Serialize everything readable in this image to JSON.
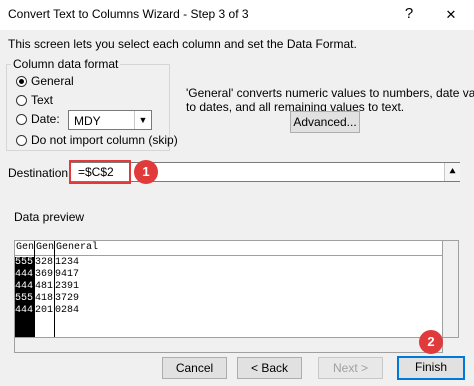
{
  "window": {
    "title": "Convert Text to Columns Wizard - Step 3 of 3",
    "help_glyph": "?",
    "close_glyph": "✕"
  },
  "intro": "This screen lets you select each column and set the Data Format.",
  "column_format": {
    "legend": "Column data format",
    "options": [
      {
        "label": "General",
        "checked": true
      },
      {
        "label": "Text",
        "checked": false
      },
      {
        "label": "Date:",
        "checked": false
      },
      {
        "label": "Do not import column (skip)",
        "checked": false
      }
    ],
    "date_format": "MDY"
  },
  "description": {
    "line1": "'General' converts numeric values to numbers, date values",
    "line2": "to dates, and all remaining values to text."
  },
  "advanced_label": "Advanced...",
  "destination": {
    "label": "Destination:",
    "value": "=$C$2"
  },
  "annotations": {
    "badge1": "1",
    "badge2": "2",
    "accent": "#e03a3a"
  },
  "preview": {
    "label": "Data preview",
    "headers": [
      "Gen",
      "Gen",
      "General"
    ],
    "rows": [
      {
        "c1": "555",
        "c2": "328",
        "c3": "1234"
      },
      {
        "c1": "444",
        "c2": "369",
        "c3": "9417"
      },
      {
        "c1": "444",
        "c2": "481",
        "c3": "2391"
      },
      {
        "c1": "555",
        "c2": "418",
        "c3": "3729"
      },
      {
        "c1": "444",
        "c2": "201",
        "c3": "0284"
      }
    ]
  },
  "buttons": {
    "cancel": "Cancel",
    "back": "< Back",
    "next": "Next >",
    "finish": "Finish"
  }
}
